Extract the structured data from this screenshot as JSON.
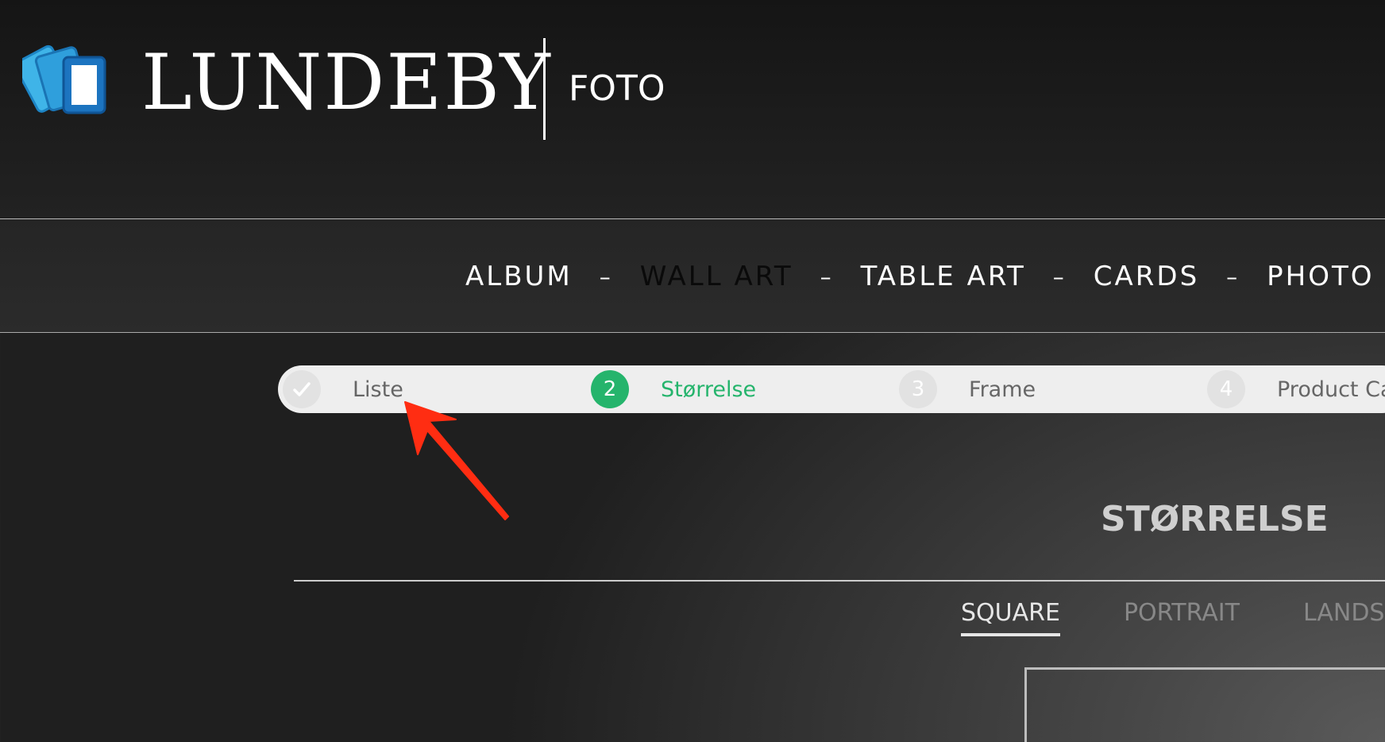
{
  "logo": {
    "wordmark": "LUNDEBY",
    "subtitle": "FOTO",
    "icon": "photo-stack-icon"
  },
  "nav": {
    "items": [
      {
        "label": "ALBUM",
        "active": false
      },
      {
        "label": "WALL ART",
        "active": true
      },
      {
        "label": "TABLE ART",
        "active": false
      },
      {
        "label": "CARDS",
        "active": false
      },
      {
        "label": "PHOTO P",
        "active": false
      }
    ],
    "separator": "–"
  },
  "stepper": {
    "steps": [
      {
        "number": "",
        "label": "Liste",
        "state": "completed",
        "icon": "checkmark-icon"
      },
      {
        "number": "2",
        "label": "Størrelse",
        "state": "current"
      },
      {
        "number": "3",
        "label": "Frame",
        "state": "upcoming"
      },
      {
        "number": "4",
        "label": "Product Ca",
        "state": "upcoming"
      }
    ]
  },
  "section": {
    "title": "STØRRELSE"
  },
  "orientation_tabs": [
    {
      "label": "SQUARE",
      "active": true
    },
    {
      "label": "PORTRAIT",
      "active": false
    },
    {
      "label": "LANDS",
      "active": false
    }
  ],
  "colors": {
    "accent_green": "#25b46c",
    "annotation_arrow": "#ff2d12"
  }
}
